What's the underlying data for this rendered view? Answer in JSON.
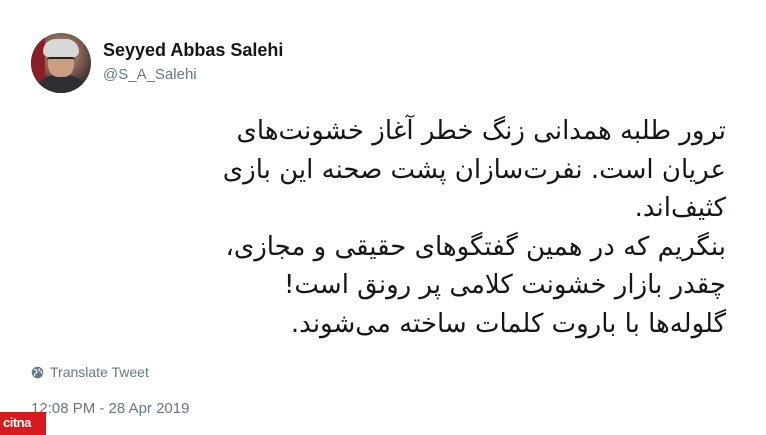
{
  "author": {
    "name": "Seyyed Abbas Salehi",
    "handle": "@S_A_Salehi"
  },
  "tweet": {
    "lines": [
      "ترور طلبه همدانی زنگ خطر آغاز خشونت‌های",
      "عریان است. نفرت‌سازان پشت صحنه این بازی",
      "کثیف‌اند.",
      "بنگریم که در همین گفتگوهای حقیقی و مجازی،",
      "چقدر بازار خشونت کلامی پر رونق است!",
      "گلوله‌ها با باروت کلمات ساخته می‌شوند."
    ]
  },
  "translate_label": "Translate Tweet",
  "timestamp": "12:08 PM - 28 Apr 2019",
  "watermark": "citna",
  "icons": {
    "translate": "globe-icon"
  },
  "colors": {
    "text": "#14171a",
    "muted": "#657786",
    "watermark": "#d71920"
  }
}
